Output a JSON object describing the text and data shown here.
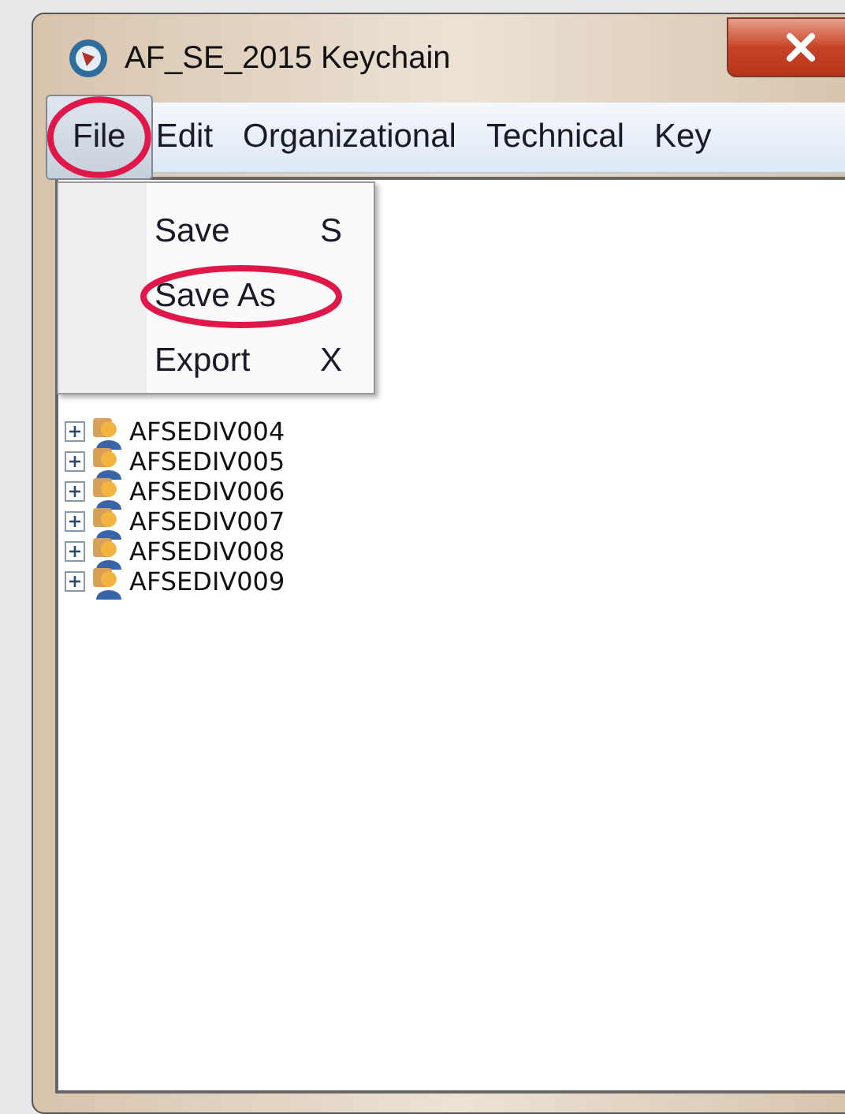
{
  "window": {
    "title": "AF_SE_2015 Keychain"
  },
  "menu_bar": [
    {
      "label": "File",
      "selected": true,
      "circled": true
    },
    {
      "label": "Edit",
      "selected": false,
      "circled": false
    },
    {
      "label": "Organizational",
      "selected": false,
      "circled": false
    },
    {
      "label": "Technical",
      "selected": false,
      "circled": false
    },
    {
      "label": "Key",
      "selected": false,
      "circled": false
    }
  ],
  "file_menu": [
    {
      "label": "Save",
      "shortcut": "S",
      "circled": false
    },
    {
      "label": "Save As",
      "circled": true
    },
    {
      "label": "Export",
      "shortcut": "X",
      "circled": false
    }
  ],
  "tree": [
    {
      "label": "AFSEDIV004",
      "expanded": false
    },
    {
      "label": "AFSEDIV005",
      "expanded": false
    },
    {
      "label": "AFSEDIV006",
      "expanded": false
    },
    {
      "label": "AFSEDIV007",
      "expanded": false
    },
    {
      "label": "AFSEDIV008",
      "expanded": false
    },
    {
      "label": "AFSEDIV009",
      "expanded": false
    }
  ]
}
